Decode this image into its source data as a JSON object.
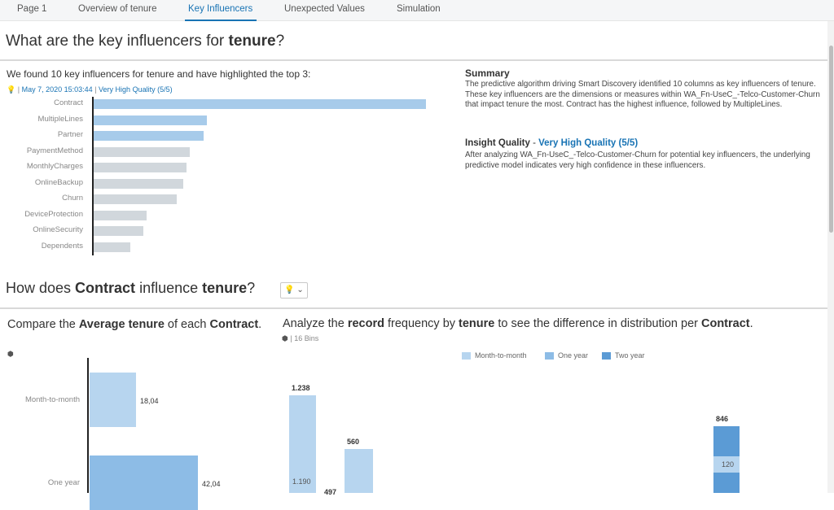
{
  "tabs": [
    {
      "label": "Page 1"
    },
    {
      "label": "Overview of tenure"
    },
    {
      "label": "Key Influencers"
    },
    {
      "label": "Unexpected Values"
    },
    {
      "label": "Simulation"
    }
  ],
  "heading": {
    "prefix": "What are the key influencers for ",
    "target": "tenure",
    "suffix": "?"
  },
  "influencers": {
    "subtitle": "We found 10 key influencers for tenure and have highlighted the top 3:",
    "date": "May 7, 2020 15:03:44",
    "quality": "Very High Quality (5/5)",
    "highlight_color": "#a7cbea",
    "normal_color": "#d1d7dc",
    "items": [
      {
        "label": "Contract",
        "value": 1.0,
        "highlight": true
      },
      {
        "label": "MultipleLines",
        "value": 0.34,
        "highlight": true
      },
      {
        "label": "Partner",
        "value": 0.33,
        "highlight": true
      },
      {
        "label": "PaymentMethod",
        "value": 0.29,
        "highlight": false
      },
      {
        "label": "MonthlyCharges",
        "value": 0.28,
        "highlight": false
      },
      {
        "label": "OnlineBackup",
        "value": 0.27,
        "highlight": false
      },
      {
        "label": "Churn",
        "value": 0.25,
        "highlight": false
      },
      {
        "label": "DeviceProtection",
        "value": 0.16,
        "highlight": false
      },
      {
        "label": "OnlineSecurity",
        "value": 0.15,
        "highlight": false
      },
      {
        "label": "Dependents",
        "value": 0.11,
        "highlight": false
      }
    ]
  },
  "summary": {
    "title": "Summary",
    "text": "The predictive algorithm driving Smart Discovery identified 10 columns as key influencers of tenure. These key influencers are the dimensions or measures within WA_Fn-UseC_-Telco-Customer-Churn that impact tenure the most. Contract has the highest influence, followed by MultipleLines.",
    "iq_label": "Insight Quality",
    "iq_dash": " - ",
    "iq_value": "Very High Quality (5/5)",
    "iq_text": "After analyzing WA_Fn-UseC_-Telco-Customer-Churn for potential key influencers, the underlying predictive model indicates very high confidence in these influencers."
  },
  "section2": {
    "p1": "How does ",
    "b1": "Contract",
    "p2": " influence ",
    "b2": "tenure",
    "p3": "?",
    "button_label": "💡 ⌄"
  },
  "compare": {
    "p1": "Compare the ",
    "b1": "Average tenure",
    "p2": " of each ",
    "b2": "Contract",
    "p3": ".",
    "icon": "cube-icon"
  },
  "analyze": {
    "p1": "Analyze the ",
    "b1": "record",
    "p2": " frequency by ",
    "b2": "tenure",
    "p3": " to see the difference in distribution per ",
    "b3": "Contract",
    "p4": ".",
    "bins": "16 Bins"
  },
  "chart_data": [
    {
      "type": "bar",
      "orientation": "horizontal",
      "categories": [
        "Month-to-month",
        "One year"
      ],
      "values": [
        18.04,
        42.04
      ],
      "value_labels": [
        "18,04",
        "42,04"
      ],
      "colors": [
        "#b7d5ef",
        "#8dbce6"
      ]
    },
    {
      "type": "bar",
      "stacked": true,
      "legend": [
        "Month-to-month",
        "One year",
        "Two year"
      ],
      "legend_colors": [
        "#b7d5ef",
        "#8dbce6",
        "#5b9bd5"
      ],
      "series_visible": [
        {
          "total": 1238,
          "total_label": "1.238",
          "inner": 1190,
          "inner_label": "1.190"
        },
        {
          "total_label": "497"
        },
        {
          "total": 560,
          "total_label": "560"
        },
        {
          "total": 846,
          "total_label": "846",
          "inner": 120,
          "inner_label": "120"
        }
      ]
    }
  ]
}
